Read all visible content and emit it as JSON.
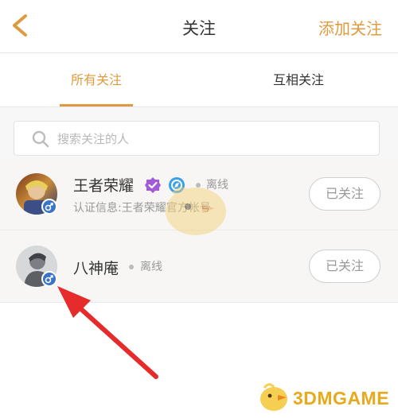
{
  "header": {
    "title": "关注",
    "add_label": "添加关注"
  },
  "tabs": [
    {
      "label": "所有关注",
      "active": true
    },
    {
      "label": "互相关注",
      "active": false
    }
  ],
  "search": {
    "placeholder": "搜索关注的人"
  },
  "follows": [
    {
      "name": "王者荣耀",
      "status": "离线",
      "info": "认证信息:王者荣耀官方帐号",
      "button": "已关注"
    },
    {
      "name": "八神庵",
      "status": "离线",
      "button": "已关注"
    }
  ],
  "watermark": {
    "logo_text": "3DMGAME"
  },
  "colors": {
    "accent": "#e09a3e",
    "arrow": "#e52b2b",
    "gender_badge": "#3a73c8",
    "logo": "#e8aa1c"
  }
}
